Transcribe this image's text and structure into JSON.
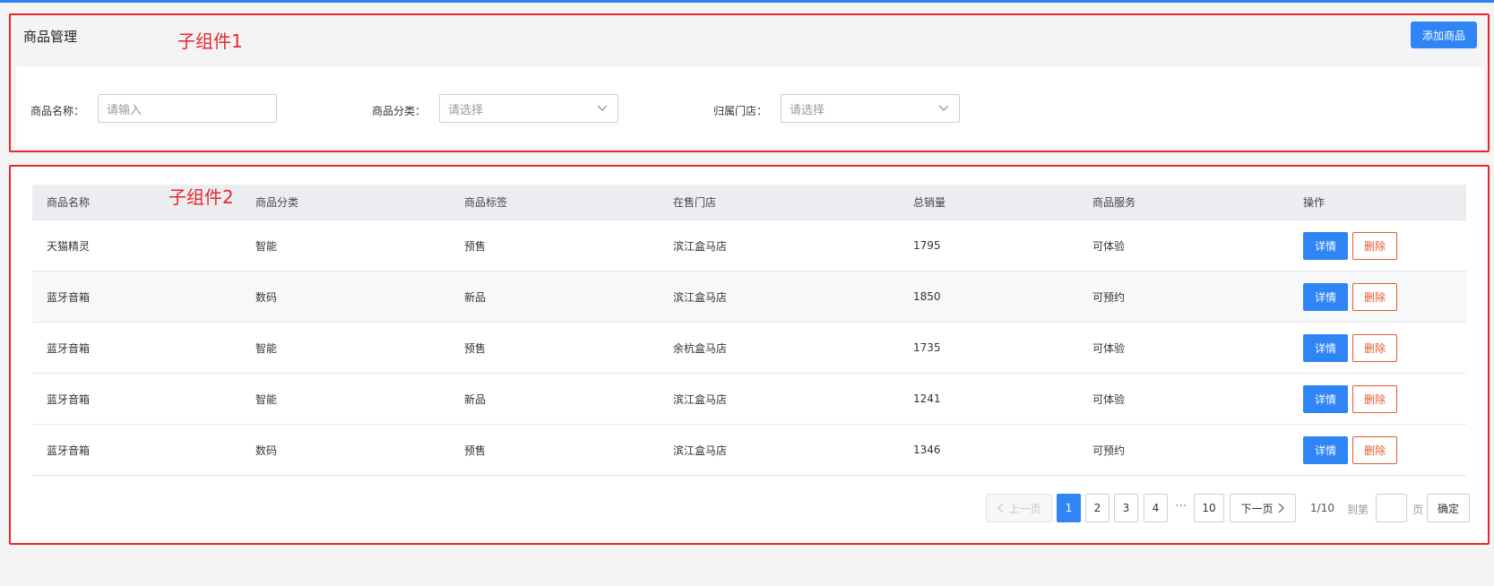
{
  "colors": {
    "primary": "#2f84f6",
    "danger": "#e25c2c",
    "annotation": "#e8262a"
  },
  "annotations": {
    "box1_label": "子组件1",
    "box2_label": "子组件2"
  },
  "header": {
    "title": "商品管理",
    "add_button": "添加商品"
  },
  "filters": [
    {
      "label": "商品名称：",
      "placeholder": "请输入",
      "type": "input"
    },
    {
      "label": "商品分类：",
      "placeholder": "请选择",
      "type": "select"
    },
    {
      "label": "归属门店：",
      "placeholder": "请选择",
      "type": "select"
    }
  ],
  "table": {
    "columns": [
      "商品名称",
      "商品分类",
      "商品标签",
      "在售门店",
      "总销量",
      "商品服务",
      "操作"
    ],
    "rows": [
      [
        "天猫精灵",
        "智能",
        "预售",
        "滨江盒马店",
        "1795",
        "可体验"
      ],
      [
        "蓝牙音箱",
        "数码",
        "新品",
        "滨江盒马店",
        "1850",
        "可预约"
      ],
      [
        "蓝牙音箱",
        "智能",
        "预售",
        "余杭盒马店",
        "1735",
        "可体验"
      ],
      [
        "蓝牙音箱",
        "智能",
        "新品",
        "滨江盒马店",
        "1241",
        "可体验"
      ],
      [
        "蓝牙音箱",
        "数码",
        "预售",
        "滨江盒马店",
        "1346",
        "可预约"
      ]
    ],
    "detail_label": "详情",
    "delete_label": "删除"
  },
  "pagination": {
    "prev": "上一页",
    "next": "下一页",
    "pages": [
      "1",
      "2",
      "3",
      "4",
      "10"
    ],
    "ellipsis": "···",
    "current": "1",
    "summary": "1/10",
    "goto_prefix": "到第",
    "goto_suffix": "页",
    "confirm": "确定"
  }
}
